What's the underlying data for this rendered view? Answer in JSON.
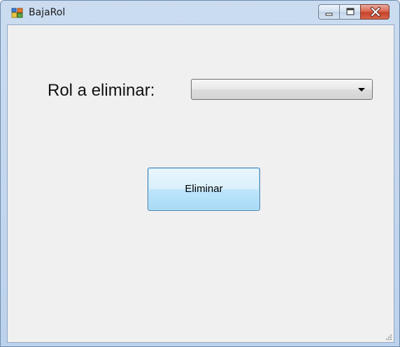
{
  "window": {
    "title": "BajaRol"
  },
  "form": {
    "role_label": "Rol a eliminar:",
    "role_selected": "",
    "delete_button": "Eliminar"
  },
  "icons": {
    "app": "form-icon",
    "minimize": "minimize-icon",
    "maximize": "maximize-icon",
    "close": "close-icon",
    "dropdown": "chevron-down-icon",
    "resize": "resize-grip-icon"
  },
  "colors": {
    "accent": "#3c7fb1",
    "close_button": "#c8422a",
    "client_bg": "#f0f0f0"
  }
}
